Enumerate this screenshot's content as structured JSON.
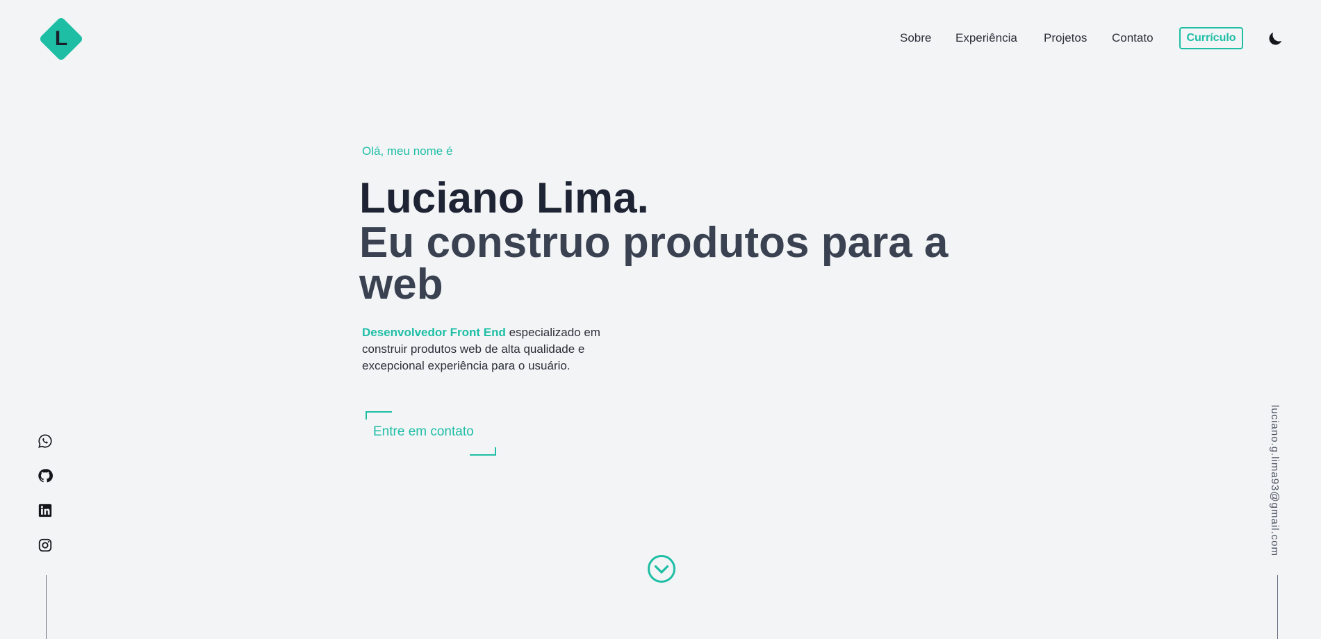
{
  "header": {
    "logo_letter": "L",
    "nav": {
      "sobre": "Sobre",
      "experiencia": "Experiência",
      "projetos": "Projetos",
      "contato": "Contato"
    },
    "cv_button": "Currículo",
    "theme_icon": "moon-icon"
  },
  "hero": {
    "greeting": "Olá, meu nome é",
    "name": "Luciano Lima.",
    "tagline": "Eu construo produtos para a web",
    "description_highlight": "Desenvolvedor Front End",
    "description_rest": " especializado em construir produtos web de alta qualidade e excepcional experiência para o usuário.",
    "cta_label": "Entre em contato"
  },
  "social": {
    "icons": [
      "whatsapp-icon",
      "github-icon",
      "linkedin-icon",
      "instagram-icon"
    ]
  },
  "email": "luciano.g.lima93@gmail.com",
  "scroll_icon": "chevron-down-circle-icon",
  "colors": {
    "accent": "#1ebea5",
    "background": "#f2f4f6",
    "heading": "#1e2433",
    "subheading": "#3a4252"
  }
}
